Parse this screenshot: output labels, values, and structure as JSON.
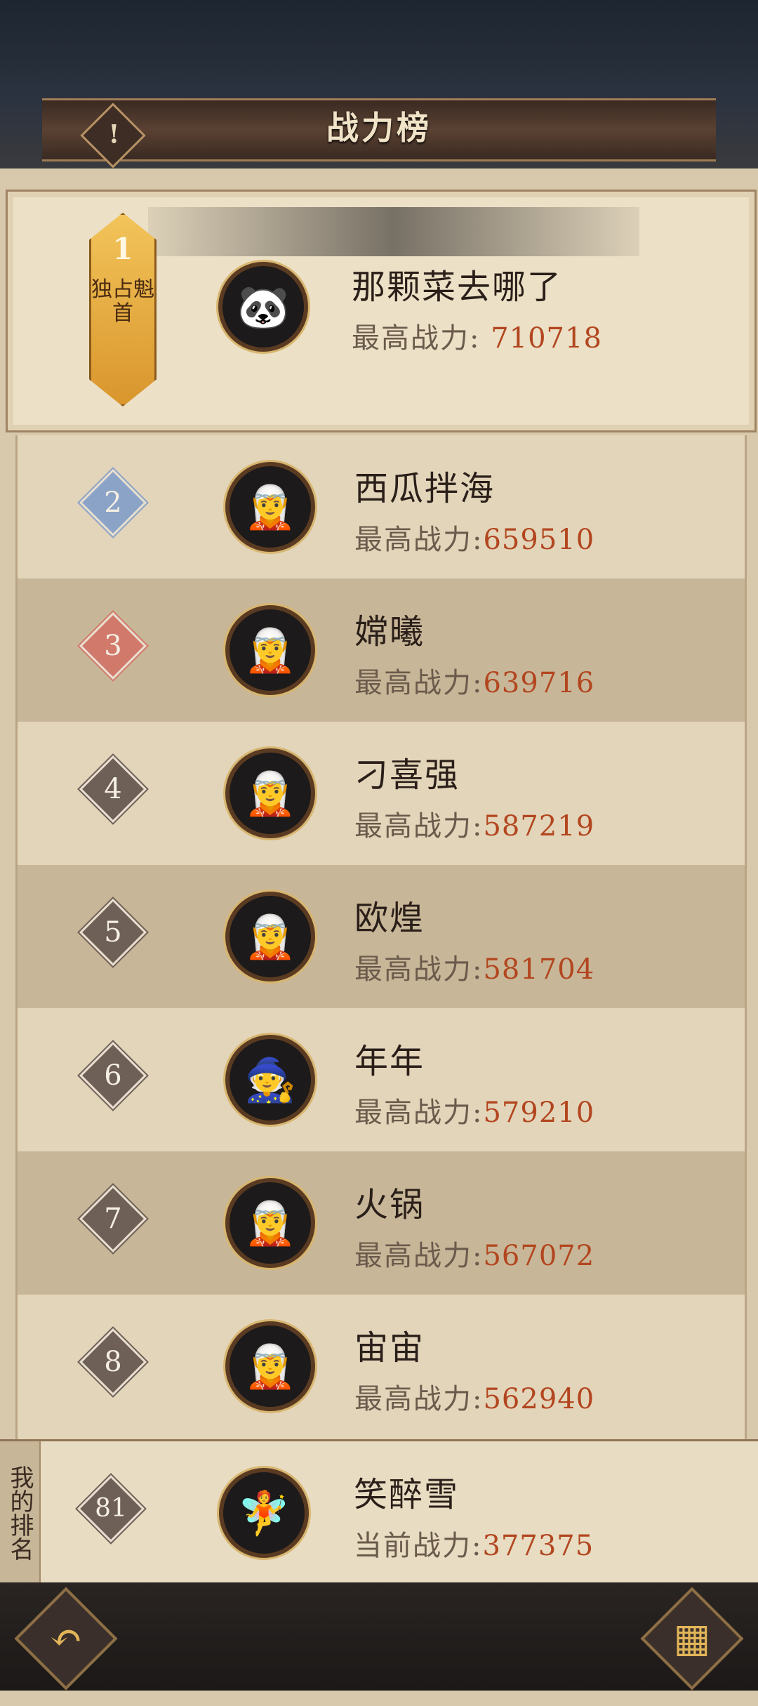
{
  "header": {
    "title": "战力榜",
    "info_icon": "exclamation-icon"
  },
  "top": {
    "rank_num": "1",
    "badge_text": "独占魁首",
    "name": "那颗菜去哪了",
    "power_label": "最高战力:",
    "power_value": "710718"
  },
  "rows": [
    {
      "rank": "2",
      "name": "西瓜拌海",
      "power_label": "最高战力:",
      "power_value": "659510"
    },
    {
      "rank": "3",
      "name": "嫦曦",
      "power_label": "最高战力:",
      "power_value": "639716"
    },
    {
      "rank": "4",
      "name": "刁喜强",
      "power_label": "最高战力:",
      "power_value": "587219"
    },
    {
      "rank": "5",
      "name": "欧煌",
      "power_label": "最高战力:",
      "power_value": "581704"
    },
    {
      "rank": "6",
      "name": "年年",
      "power_label": "最高战力:",
      "power_value": "579210"
    },
    {
      "rank": "7",
      "name": "火锅",
      "power_label": "最高战力:",
      "power_value": "567072"
    },
    {
      "rank": "8",
      "name": "宙宙",
      "power_label": "最高战力:",
      "power_value": "562940"
    }
  ],
  "mine": {
    "label": "我的排名",
    "rank": "81",
    "name": "笑醉雪",
    "power_label": "当前战力:",
    "power_value": "377375"
  },
  "footer": {
    "back_icon": "back-arrow-icon",
    "menu_icon": "menu-icon"
  },
  "colors": {
    "accent_gold": "#d9962d",
    "value_red": "#b2461f"
  }
}
